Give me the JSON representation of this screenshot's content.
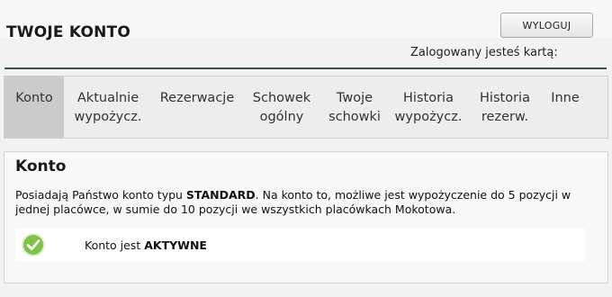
{
  "header": {
    "title": "TWOJE KONTO",
    "logout_label": "WYLOGUJ",
    "login_info": "Zalogowany jesteś kartą:"
  },
  "tabs": [
    {
      "lines": [
        "Konto"
      ],
      "active": true
    },
    {
      "lines": [
        "Aktualnie",
        "wypożycz."
      ],
      "active": false
    },
    {
      "lines": [
        "Rezerwacje"
      ],
      "active": false
    },
    {
      "lines": [
        "Schowek",
        "ogólny"
      ],
      "active": false
    },
    {
      "lines": [
        "Twoje",
        "schowki"
      ],
      "active": false
    },
    {
      "lines": [
        "Historia",
        "wypożycz."
      ],
      "active": false
    },
    {
      "lines": [
        "Historia",
        "rezerw."
      ],
      "active": false
    },
    {
      "lines": [
        "Inne"
      ],
      "active": false
    }
  ],
  "account": {
    "title": "Konto",
    "desc_prefix": "Posiadają Państwo konto typu ",
    "desc_type": "STANDARD",
    "desc_suffix": ". Na konto to, możliwe jest wypożyczenie do 5 pozycji w jednej placówce, w sumie do 10 pozycji we wszystkich placówkach Mokotowa.",
    "status_prefix": "Konto jest ",
    "status_value": "AKTYWNE",
    "status_icon": "check-circle-icon",
    "status_color": "#7fc24a"
  }
}
